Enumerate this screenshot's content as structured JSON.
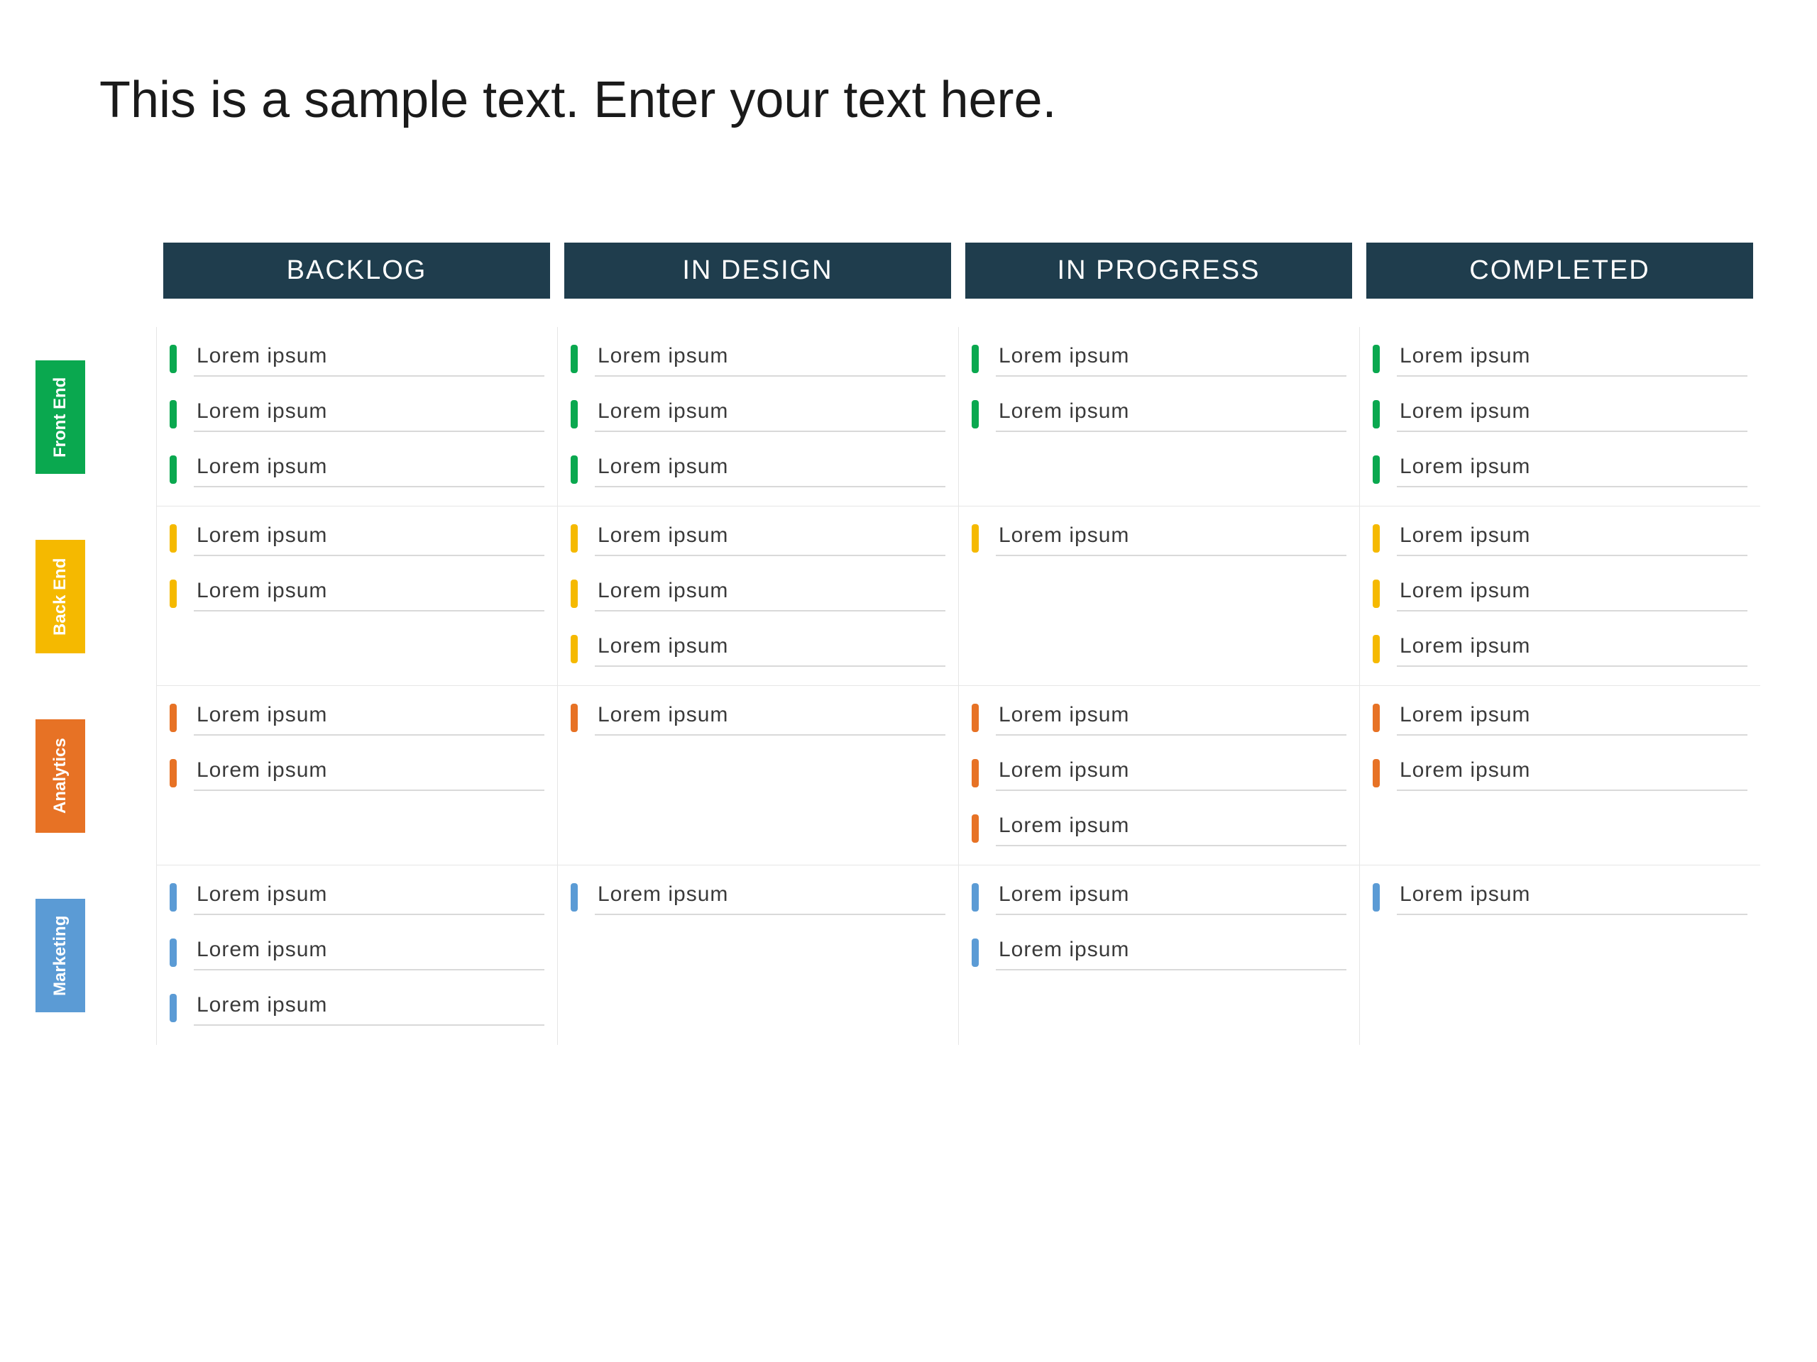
{
  "title": "This is a sample text. Enter your text here.",
  "columns": [
    "BACKLOG",
    "IN DESIGN",
    "IN PROGRESS",
    "COMPLETED"
  ],
  "rows": [
    {
      "label": "Front End",
      "color": "#0aa84f",
      "cells": [
        [
          "Lorem ipsum",
          "Lorem ipsum",
          "Lorem ipsum"
        ],
        [
          "Lorem ipsum",
          "Lorem ipsum",
          "Lorem ipsum"
        ],
        [
          "Lorem ipsum",
          "Lorem ipsum"
        ],
        [
          "Lorem ipsum",
          "Lorem ipsum",
          "Lorem ipsum"
        ]
      ]
    },
    {
      "label": "Back End",
      "color": "#f5b900",
      "cells": [
        [
          "Lorem ipsum",
          "Lorem ipsum"
        ],
        [
          "Lorem ipsum",
          "Lorem ipsum",
          "Lorem ipsum"
        ],
        [
          "Lorem ipsum"
        ],
        [
          "Lorem ipsum",
          "Lorem ipsum",
          "Lorem ipsum"
        ]
      ]
    },
    {
      "label": "Analytics",
      "color": "#e77225",
      "cells": [
        [
          "Lorem ipsum",
          "Lorem ipsum"
        ],
        [
          "Lorem ipsum"
        ],
        [
          "Lorem ipsum",
          "Lorem ipsum",
          "Lorem ipsum"
        ],
        [
          "Lorem ipsum",
          "Lorem ipsum"
        ]
      ]
    },
    {
      "label": "Marketing",
      "color": "#5b9bd5",
      "cells": [
        [
          "Lorem ipsum",
          "Lorem ipsum",
          "Lorem ipsum"
        ],
        [
          "Lorem ipsum"
        ],
        [
          "Lorem ipsum",
          "Lorem ipsum"
        ],
        [
          "Lorem ipsum"
        ]
      ]
    }
  ]
}
